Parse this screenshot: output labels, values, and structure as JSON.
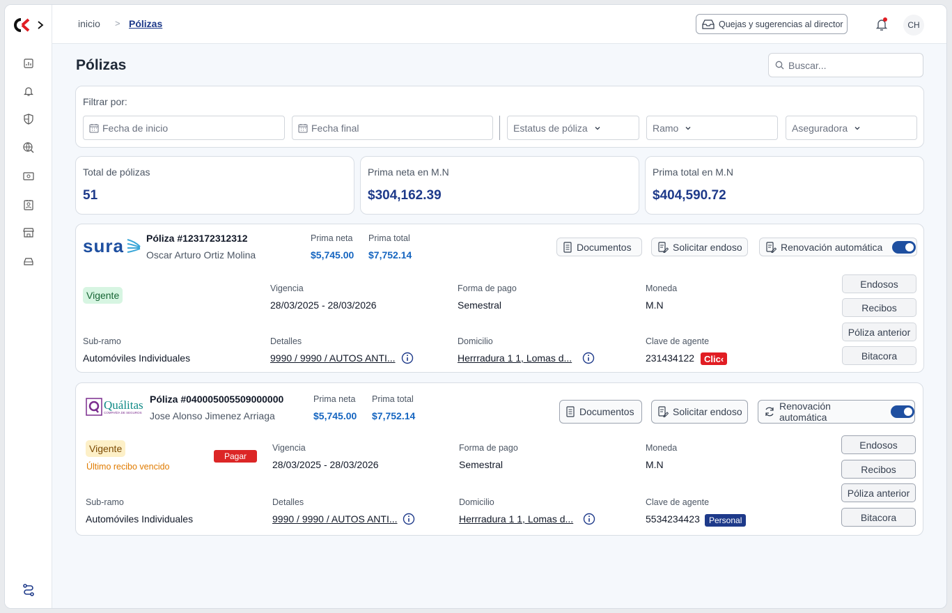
{
  "header": {
    "breadcrumb_home": "inicio",
    "breadcrumb_sep": ">",
    "breadcrumb_current": "Pólizas",
    "complaints_button": "Quejas y sugerencias al director",
    "avatar_initials": "CH"
  },
  "sidebar": {
    "items": [
      "dashboard-icon",
      "bell-icon",
      "shield-icon",
      "globe-icon",
      "money-icon",
      "contact-card-icon",
      "store-icon",
      "car-icon"
    ],
    "bottom": "route-icon"
  },
  "page": {
    "title": "Pólizas",
    "search_placeholder": "Buscar..."
  },
  "filters": {
    "label": "Filtrar por:",
    "start_date": "Fecha de inicio",
    "end_date": "Fecha final",
    "status": "Estatus de póliza",
    "branch": "Ramo",
    "insurer": "Aseguradora"
  },
  "stats": [
    {
      "label": "Total de pólizas",
      "value": "51"
    },
    {
      "label": "Prima neta en M.N",
      "value": "$304,162.39"
    },
    {
      "label": "Prima total en M.N",
      "value": "$404,590.72"
    }
  ],
  "labels": {
    "prima_neta": "Prima neta",
    "prima_total": "Prima total",
    "documentos": "Documentos",
    "solicitar_endoso": "Solicitar endoso",
    "renovacion": "Renovación automática",
    "vigencia": "Vigencia",
    "forma_pago": "Forma de pago",
    "moneda": "Moneda",
    "sub_ramo": "Sub-ramo",
    "detalles": "Detalles",
    "domicilio": "Domicilio",
    "clave_agente": "Clave de agente",
    "endosos": "Endosos",
    "recibos": "Recibos",
    "poliza_anterior": "Póliza anterior",
    "bitacora": "Bitacora"
  },
  "policies": [
    {
      "insurer_logo_text": "sura",
      "number": "Póliza #123172312312",
      "holder": "Oscar Arturo Ortiz Molina",
      "prima_neta": "$5,745.00",
      "prima_total": "$7,752.14",
      "status": "Vigente",
      "vigencia": "28/03/2025 - 28/03/2026",
      "forma_pago": "Semestral",
      "moneda": "M.N",
      "sub_ramo": "Automóviles Individuales",
      "detalles": "9990 / 9990 / AUTOS ANTI...",
      "domicilio": "Herrradura 1 1, Lomas d...",
      "clave_agente": "231434122",
      "agent_tag": "Clic‹",
      "auto_renew": true
    },
    {
      "insurer_logo_text": "Quálitas",
      "insurer_logo_sub": "COMPAÑÍA DE SEGUROS",
      "number": "Póliza #040005005509000000",
      "holder": "Jose Alonso Jimenez Arriaga",
      "prima_neta": "$5,745.00",
      "prima_total": "$7,752.14",
      "status": "Vigente",
      "status_note": "Último recibo vencido",
      "pay_label": "Pagar",
      "vigencia": "28/03/2025 - 28/03/2026",
      "forma_pago": "Semestral",
      "moneda": "M.N",
      "sub_ramo": "Automóviles Individuales",
      "detalles": "9990 / 9990 / AUTOS ANTI...",
      "domicilio": "Herrradura 1 1, Lomas d...",
      "clave_agente": "5534234423",
      "agent_tag": "Personal",
      "auto_renew": true
    }
  ],
  "colors": {
    "primary": "#1e3a8a",
    "accent_blue": "#1565c0",
    "danger": "#dc2626",
    "success_bg": "#d7f5e2",
    "warning_bg": "#fdf0c8"
  }
}
